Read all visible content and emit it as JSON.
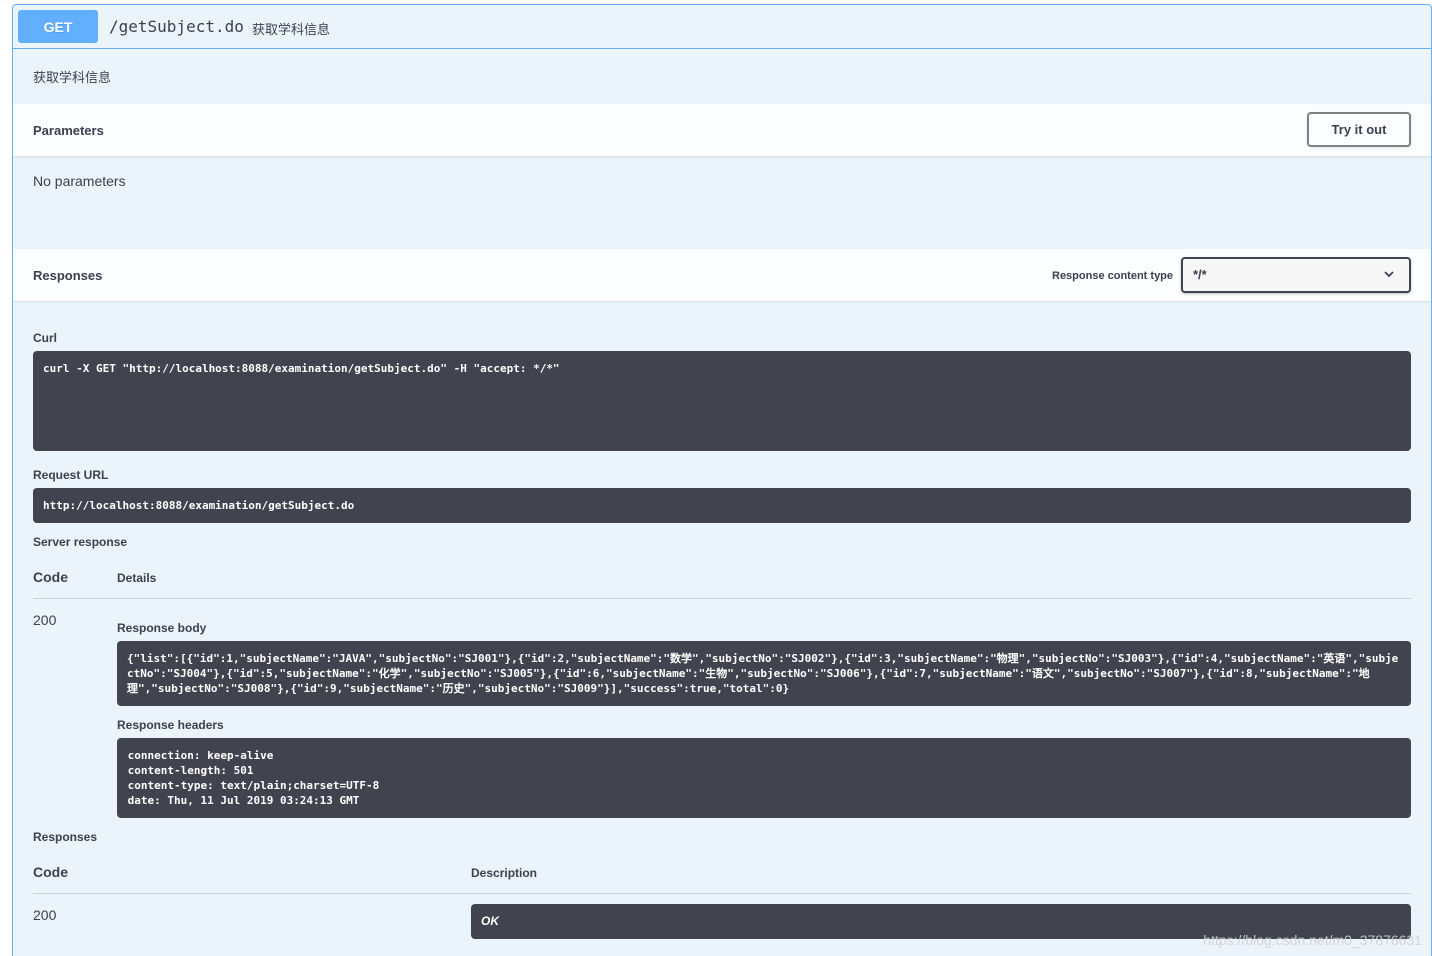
{
  "operation": {
    "method": "GET",
    "path": "/getSubject.do",
    "summary": "获取学科信息",
    "description": "获取学科信息"
  },
  "parameters": {
    "title": "Parameters",
    "try_button": "Try it out",
    "empty_text": "No parameters"
  },
  "responses_header": {
    "title": "Responses",
    "content_type_label": "Response content type",
    "content_type_value": "*/*"
  },
  "curl": {
    "label": "Curl",
    "command": "curl -X GET \"http://localhost:8088/examination/getSubject.do\" -H \"accept: */*\""
  },
  "request_url": {
    "label": "Request URL",
    "value": "http://localhost:8088/examination/getSubject.do"
  },
  "server_response": {
    "label": "Server response",
    "code_header": "Code",
    "details_header": "Details",
    "code": "200",
    "body_label": "Response body",
    "body": "{\"list\":[{\"id\":1,\"subjectName\":\"JAVA\",\"subjectNo\":\"SJ001\"},{\"id\":2,\"subjectName\":\"数学\",\"subjectNo\":\"SJ002\"},{\"id\":3,\"subjectName\":\"物理\",\"subjectNo\":\"SJ003\"},{\"id\":4,\"subjectName\":\"英语\",\"subjectNo\":\"SJ004\"},{\"id\":5,\"subjectName\":\"化学\",\"subjectNo\":\"SJ005\"},{\"id\":6,\"subjectName\":\"生物\",\"subjectNo\":\"SJ006\"},{\"id\":7,\"subjectName\":\"语文\",\"subjectNo\":\"SJ007\"},{\"id\":8,\"subjectName\":\"地理\",\"subjectNo\":\"SJ008\"},{\"id\":9,\"subjectName\":\"历史\",\"subjectNo\":\"SJ009\"}],\"success\":true,\"total\":0}",
    "headers_label": "Response headers",
    "headers": " connection: keep-alive\n content-length: 501\n content-type: text/plain;charset=UTF-8\n date: Thu, 11 Jul 2019 03:24:13 GMT"
  },
  "responses": {
    "label": "Responses",
    "code_header": "Code",
    "description_header": "Description",
    "rows": [
      {
        "code": "200",
        "description": "OK"
      }
    ]
  },
  "watermark": "https://blog.csdn.net/m0_37876631"
}
